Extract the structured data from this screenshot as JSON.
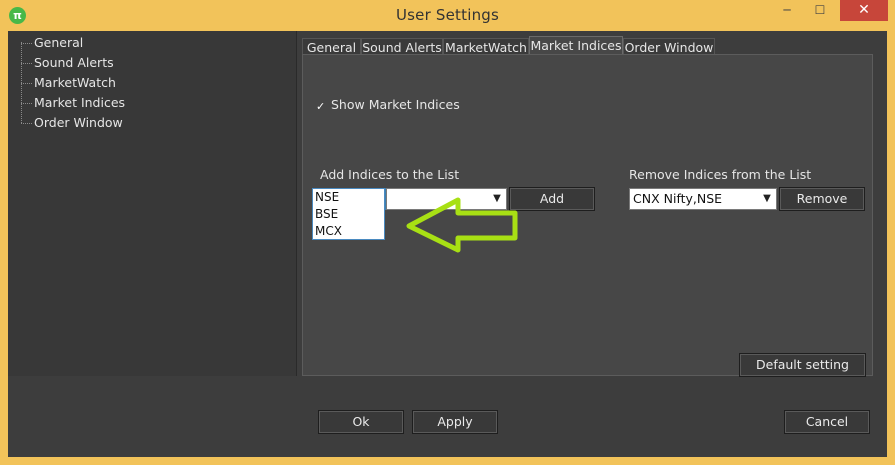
{
  "window": {
    "title": "User Settings",
    "app_icon_glyph": "π",
    "minimize_glyph": "─",
    "maximize_glyph": "☐",
    "close_glyph": "✕"
  },
  "sidebar": {
    "items": [
      {
        "label": "General"
      },
      {
        "label": "Sound Alerts"
      },
      {
        "label": "MarketWatch"
      },
      {
        "label": "Market Indices"
      },
      {
        "label": "Order Window"
      }
    ]
  },
  "tabs": [
    {
      "label": "General"
    },
    {
      "label": "Sound Alerts"
    },
    {
      "label": "MarketWatch"
    },
    {
      "label": "Market Indices",
      "active": true
    },
    {
      "label": "Order Window"
    }
  ],
  "panel": {
    "show_indices_label": "Show Market Indices",
    "show_indices_checked": true,
    "checkmark_glyph": "✓",
    "add_section_label": "Add Indices to the List",
    "exchange_select_value": "",
    "index_select_value": "",
    "add_button": "Add",
    "remove_section_label": "Remove Indices from the List",
    "remove_select_value": "CNX Nifty,NSE",
    "remove_button": "Remove",
    "default_button": "Default setting",
    "dropdown_arrow_glyph": "▼",
    "exchange_options": [
      "NSE",
      "BSE",
      "MCX"
    ]
  },
  "footer": {
    "ok_button": "Ok",
    "apply_button": "Apply",
    "cancel_button": "Cancel"
  },
  "colors": {
    "window_frame": "#f2c35a",
    "annotation_arrow": "#a8e014",
    "close_button": "#c7463a"
  },
  "icons": {
    "app": "pi-app-icon",
    "annotation": "left-arrow-annotation-icon"
  }
}
